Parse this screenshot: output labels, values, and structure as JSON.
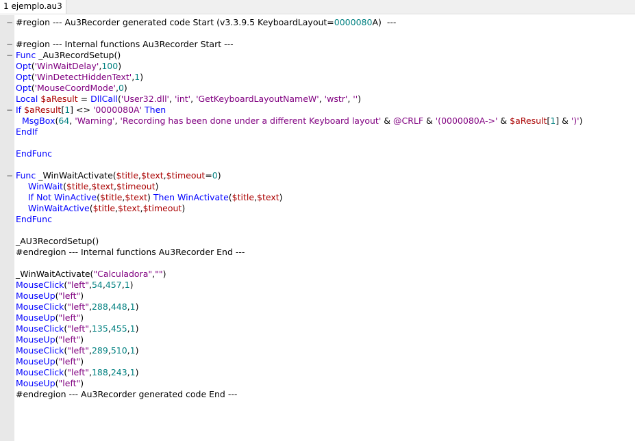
{
  "tab": {
    "label": "1 ejemplo.au3"
  },
  "colors": {
    "keyword": "#0000ff",
    "function": "#000090",
    "builtin": "#0000ff",
    "variable": "#aa0000",
    "string": "#800080",
    "number": "#008080",
    "operator": "#800000",
    "gutter": "#e8e8e8"
  },
  "editor": {
    "lines": [
      {
        "fold": "−",
        "indent": 0,
        "tokens": [
          {
            "t": "dir",
            "v": "#region --- Au3Recorder generated code Start (v3.3.9.5 KeyboardLayout="
          },
          {
            "t": "num",
            "v": "0000080"
          },
          {
            "t": "dir",
            "v": "A)  ---"
          }
        ]
      },
      {
        "fold": "",
        "indent": 0,
        "tokens": []
      },
      {
        "fold": "−",
        "indent": 0,
        "tokens": [
          {
            "t": "dir",
            "v": "#region --- Internal functions Au3Recorder Start ---"
          }
        ]
      },
      {
        "fold": "−",
        "indent": 0,
        "tokens": [
          {
            "t": "kw",
            "v": "Func"
          },
          {
            "t": "txt",
            "v": " _Au3RecordSetup()"
          }
        ]
      },
      {
        "fold": "",
        "indent": 0,
        "tokens": [
          {
            "t": "bi",
            "v": "Opt"
          },
          {
            "t": "txt",
            "v": "("
          },
          {
            "t": "str",
            "v": "'WinWaitDelay'"
          },
          {
            "t": "txt",
            "v": ","
          },
          {
            "t": "num",
            "v": "100"
          },
          {
            "t": "txt",
            "v": ")"
          }
        ]
      },
      {
        "fold": "",
        "indent": 0,
        "tokens": [
          {
            "t": "bi",
            "v": "Opt"
          },
          {
            "t": "txt",
            "v": "("
          },
          {
            "t": "str",
            "v": "'WinDetectHiddenText'"
          },
          {
            "t": "txt",
            "v": ","
          },
          {
            "t": "num",
            "v": "1"
          },
          {
            "t": "txt",
            "v": ")"
          }
        ]
      },
      {
        "fold": "",
        "indent": 0,
        "tokens": [
          {
            "t": "bi",
            "v": "Opt"
          },
          {
            "t": "txt",
            "v": "("
          },
          {
            "t": "str",
            "v": "'MouseCoordMode'"
          },
          {
            "t": "txt",
            "v": ","
          },
          {
            "t": "num",
            "v": "0"
          },
          {
            "t": "txt",
            "v": ")"
          }
        ]
      },
      {
        "fold": "",
        "indent": 0,
        "tokens": [
          {
            "t": "kw",
            "v": "Local"
          },
          {
            "t": "txt",
            "v": " "
          },
          {
            "t": "var",
            "v": "$aResult"
          },
          {
            "t": "txt",
            "v": " = "
          },
          {
            "t": "bi",
            "v": "DllCall"
          },
          {
            "t": "txt",
            "v": "("
          },
          {
            "t": "str",
            "v": "'User32.dll'"
          },
          {
            "t": "txt",
            "v": ", "
          },
          {
            "t": "str",
            "v": "'int'"
          },
          {
            "t": "txt",
            "v": ", "
          },
          {
            "t": "str",
            "v": "'GetKeyboardLayoutNameW'"
          },
          {
            "t": "txt",
            "v": ", "
          },
          {
            "t": "str",
            "v": "'wstr'"
          },
          {
            "t": "txt",
            "v": ", "
          },
          {
            "t": "str",
            "v": "''"
          },
          {
            "t": "txt",
            "v": ")"
          }
        ]
      },
      {
        "fold": "−",
        "indent": 0,
        "tokens": [
          {
            "t": "kw",
            "v": "If"
          },
          {
            "t": "txt",
            "v": " "
          },
          {
            "t": "var",
            "v": "$aResult"
          },
          {
            "t": "txt",
            "v": "["
          },
          {
            "t": "num",
            "v": "1"
          },
          {
            "t": "txt",
            "v": "] <> "
          },
          {
            "t": "str",
            "v": "'0000080A'"
          },
          {
            "t": "txt",
            "v": " "
          },
          {
            "t": "kw",
            "v": "Then"
          }
        ]
      },
      {
        "fold": "",
        "indent": 1,
        "tokens": [
          {
            "t": "bi",
            "v": "MsgBox"
          },
          {
            "t": "txt",
            "v": "("
          },
          {
            "t": "num",
            "v": "64"
          },
          {
            "t": "txt",
            "v": ", "
          },
          {
            "t": "str",
            "v": "'Warning'"
          },
          {
            "t": "txt",
            "v": ", "
          },
          {
            "t": "str",
            "v": "'Recording has been done under a different Keyboard layout'"
          },
          {
            "t": "txt",
            "v": " & "
          },
          {
            "t": "macro",
            "v": "@CRLF"
          },
          {
            "t": "txt",
            "v": " & "
          },
          {
            "t": "str",
            "v": "'(0000080A->'"
          },
          {
            "t": "txt",
            "v": " & "
          },
          {
            "t": "var",
            "v": "$aResult"
          },
          {
            "t": "txt",
            "v": "["
          },
          {
            "t": "num",
            "v": "1"
          },
          {
            "t": "txt",
            "v": "] & "
          },
          {
            "t": "str",
            "v": "')'"
          },
          {
            "t": "txt",
            "v": ")"
          }
        ]
      },
      {
        "fold": "",
        "indent": 0,
        "tokens": [
          {
            "t": "kw",
            "v": "EndIf"
          }
        ]
      },
      {
        "fold": "",
        "indent": 0,
        "tokens": []
      },
      {
        "fold": "",
        "indent": 0,
        "tokens": [
          {
            "t": "kw",
            "v": "EndFunc"
          }
        ]
      },
      {
        "fold": "",
        "indent": 0,
        "tokens": []
      },
      {
        "fold": "−",
        "indent": 0,
        "tokens": [
          {
            "t": "kw",
            "v": "Func"
          },
          {
            "t": "txt",
            "v": " _WinWaitActivate("
          },
          {
            "t": "var",
            "v": "$title"
          },
          {
            "t": "txt",
            "v": ","
          },
          {
            "t": "var",
            "v": "$text"
          },
          {
            "t": "txt",
            "v": ","
          },
          {
            "t": "var",
            "v": "$timeout"
          },
          {
            "t": "txt",
            "v": "="
          },
          {
            "t": "num",
            "v": "0"
          },
          {
            "t": "txt",
            "v": ")"
          }
        ]
      },
      {
        "fold": "",
        "indent": 2,
        "tokens": [
          {
            "t": "bi",
            "v": "WinWait"
          },
          {
            "t": "txt",
            "v": "("
          },
          {
            "t": "var",
            "v": "$title"
          },
          {
            "t": "txt",
            "v": ","
          },
          {
            "t": "var",
            "v": "$text"
          },
          {
            "t": "txt",
            "v": ","
          },
          {
            "t": "var",
            "v": "$timeout"
          },
          {
            "t": "txt",
            "v": ")"
          }
        ]
      },
      {
        "fold": "",
        "indent": 2,
        "tokens": [
          {
            "t": "kw",
            "v": "If"
          },
          {
            "t": "txt",
            "v": " "
          },
          {
            "t": "kw",
            "v": "Not"
          },
          {
            "t": "txt",
            "v": " "
          },
          {
            "t": "bi",
            "v": "WinActive"
          },
          {
            "t": "txt",
            "v": "("
          },
          {
            "t": "var",
            "v": "$title"
          },
          {
            "t": "txt",
            "v": ","
          },
          {
            "t": "var",
            "v": "$text"
          },
          {
            "t": "txt",
            "v": ") "
          },
          {
            "t": "kw",
            "v": "Then"
          },
          {
            "t": "txt",
            "v": " "
          },
          {
            "t": "bi",
            "v": "WinActivate"
          },
          {
            "t": "txt",
            "v": "("
          },
          {
            "t": "var",
            "v": "$title"
          },
          {
            "t": "txt",
            "v": ","
          },
          {
            "t": "var",
            "v": "$text"
          },
          {
            "t": "txt",
            "v": ")"
          }
        ]
      },
      {
        "fold": "",
        "indent": 2,
        "tokens": [
          {
            "t": "bi",
            "v": "WinWaitActive"
          },
          {
            "t": "txt",
            "v": "("
          },
          {
            "t": "var",
            "v": "$title"
          },
          {
            "t": "txt",
            "v": ","
          },
          {
            "t": "var",
            "v": "$text"
          },
          {
            "t": "txt",
            "v": ","
          },
          {
            "t": "var",
            "v": "$timeout"
          },
          {
            "t": "txt",
            "v": ")"
          }
        ]
      },
      {
        "fold": "",
        "indent": 0,
        "tokens": [
          {
            "t": "kw",
            "v": "EndFunc"
          }
        ]
      },
      {
        "fold": "",
        "indent": 0,
        "tokens": []
      },
      {
        "fold": "",
        "indent": 0,
        "tokens": [
          {
            "t": "txt",
            "v": "_AU3RecordSetup()"
          }
        ]
      },
      {
        "fold": "",
        "indent": 0,
        "tokens": [
          {
            "t": "dir",
            "v": "#endregion --- Internal functions Au3Recorder End ---"
          }
        ]
      },
      {
        "fold": "",
        "indent": 0,
        "tokens": []
      },
      {
        "fold": "",
        "indent": 0,
        "tokens": [
          {
            "t": "txt",
            "v": "_WinWaitActivate("
          },
          {
            "t": "str",
            "v": "\"Calculadora\""
          },
          {
            "t": "txt",
            "v": ","
          },
          {
            "t": "str",
            "v": "\"\""
          },
          {
            "t": "txt",
            "v": ")"
          }
        ]
      },
      {
        "fold": "",
        "indent": 0,
        "tokens": [
          {
            "t": "bi",
            "v": "MouseClick"
          },
          {
            "t": "txt",
            "v": "("
          },
          {
            "t": "str",
            "v": "\"left\""
          },
          {
            "t": "txt",
            "v": ","
          },
          {
            "t": "num",
            "v": "54"
          },
          {
            "t": "txt",
            "v": ","
          },
          {
            "t": "num",
            "v": "457"
          },
          {
            "t": "txt",
            "v": ","
          },
          {
            "t": "num",
            "v": "1"
          },
          {
            "t": "txt",
            "v": ")"
          }
        ]
      },
      {
        "fold": "",
        "indent": 0,
        "tokens": [
          {
            "t": "bi",
            "v": "MouseUp"
          },
          {
            "t": "txt",
            "v": "("
          },
          {
            "t": "str",
            "v": "\"left\""
          },
          {
            "t": "txt",
            "v": ")"
          }
        ]
      },
      {
        "fold": "",
        "indent": 0,
        "tokens": [
          {
            "t": "bi",
            "v": "MouseClick"
          },
          {
            "t": "txt",
            "v": "("
          },
          {
            "t": "str",
            "v": "\"left\""
          },
          {
            "t": "txt",
            "v": ","
          },
          {
            "t": "num",
            "v": "288"
          },
          {
            "t": "txt",
            "v": ","
          },
          {
            "t": "num",
            "v": "448"
          },
          {
            "t": "txt",
            "v": ","
          },
          {
            "t": "num",
            "v": "1"
          },
          {
            "t": "txt",
            "v": ")"
          }
        ]
      },
      {
        "fold": "",
        "indent": 0,
        "tokens": [
          {
            "t": "bi",
            "v": "MouseUp"
          },
          {
            "t": "txt",
            "v": "("
          },
          {
            "t": "str",
            "v": "\"left\""
          },
          {
            "t": "txt",
            "v": ")"
          }
        ]
      },
      {
        "fold": "",
        "indent": 0,
        "tokens": [
          {
            "t": "bi",
            "v": "MouseClick"
          },
          {
            "t": "txt",
            "v": "("
          },
          {
            "t": "str",
            "v": "\"left\""
          },
          {
            "t": "txt",
            "v": ","
          },
          {
            "t": "num",
            "v": "135"
          },
          {
            "t": "txt",
            "v": ","
          },
          {
            "t": "num",
            "v": "455"
          },
          {
            "t": "txt",
            "v": ","
          },
          {
            "t": "num",
            "v": "1"
          },
          {
            "t": "txt",
            "v": ")"
          }
        ]
      },
      {
        "fold": "",
        "indent": 0,
        "tokens": [
          {
            "t": "bi",
            "v": "MouseUp"
          },
          {
            "t": "txt",
            "v": "("
          },
          {
            "t": "str",
            "v": "\"left\""
          },
          {
            "t": "txt",
            "v": ")"
          }
        ]
      },
      {
        "fold": "",
        "indent": 0,
        "tokens": [
          {
            "t": "bi",
            "v": "MouseClick"
          },
          {
            "t": "txt",
            "v": "("
          },
          {
            "t": "str",
            "v": "\"left\""
          },
          {
            "t": "txt",
            "v": ","
          },
          {
            "t": "num",
            "v": "289"
          },
          {
            "t": "txt",
            "v": ","
          },
          {
            "t": "num",
            "v": "510"
          },
          {
            "t": "txt",
            "v": ","
          },
          {
            "t": "num",
            "v": "1"
          },
          {
            "t": "txt",
            "v": ")"
          }
        ]
      },
      {
        "fold": "",
        "indent": 0,
        "tokens": [
          {
            "t": "bi",
            "v": "MouseUp"
          },
          {
            "t": "txt",
            "v": "("
          },
          {
            "t": "str",
            "v": "\"left\""
          },
          {
            "t": "txt",
            "v": ")"
          }
        ]
      },
      {
        "fold": "",
        "indent": 0,
        "tokens": [
          {
            "t": "bi",
            "v": "MouseClick"
          },
          {
            "t": "txt",
            "v": "("
          },
          {
            "t": "str",
            "v": "\"left\""
          },
          {
            "t": "txt",
            "v": ","
          },
          {
            "t": "num",
            "v": "188"
          },
          {
            "t": "txt",
            "v": ","
          },
          {
            "t": "num",
            "v": "243"
          },
          {
            "t": "txt",
            "v": ","
          },
          {
            "t": "num",
            "v": "1"
          },
          {
            "t": "txt",
            "v": ")"
          }
        ]
      },
      {
        "fold": "",
        "indent": 0,
        "tokens": [
          {
            "t": "bi",
            "v": "MouseUp"
          },
          {
            "t": "txt",
            "v": "("
          },
          {
            "t": "str",
            "v": "\"left\""
          },
          {
            "t": "txt",
            "v": ")"
          }
        ]
      },
      {
        "fold": "",
        "indent": 0,
        "tokens": [
          {
            "t": "dir",
            "v": "#endregion --- Au3Recorder generated code End ---"
          }
        ]
      }
    ]
  }
}
